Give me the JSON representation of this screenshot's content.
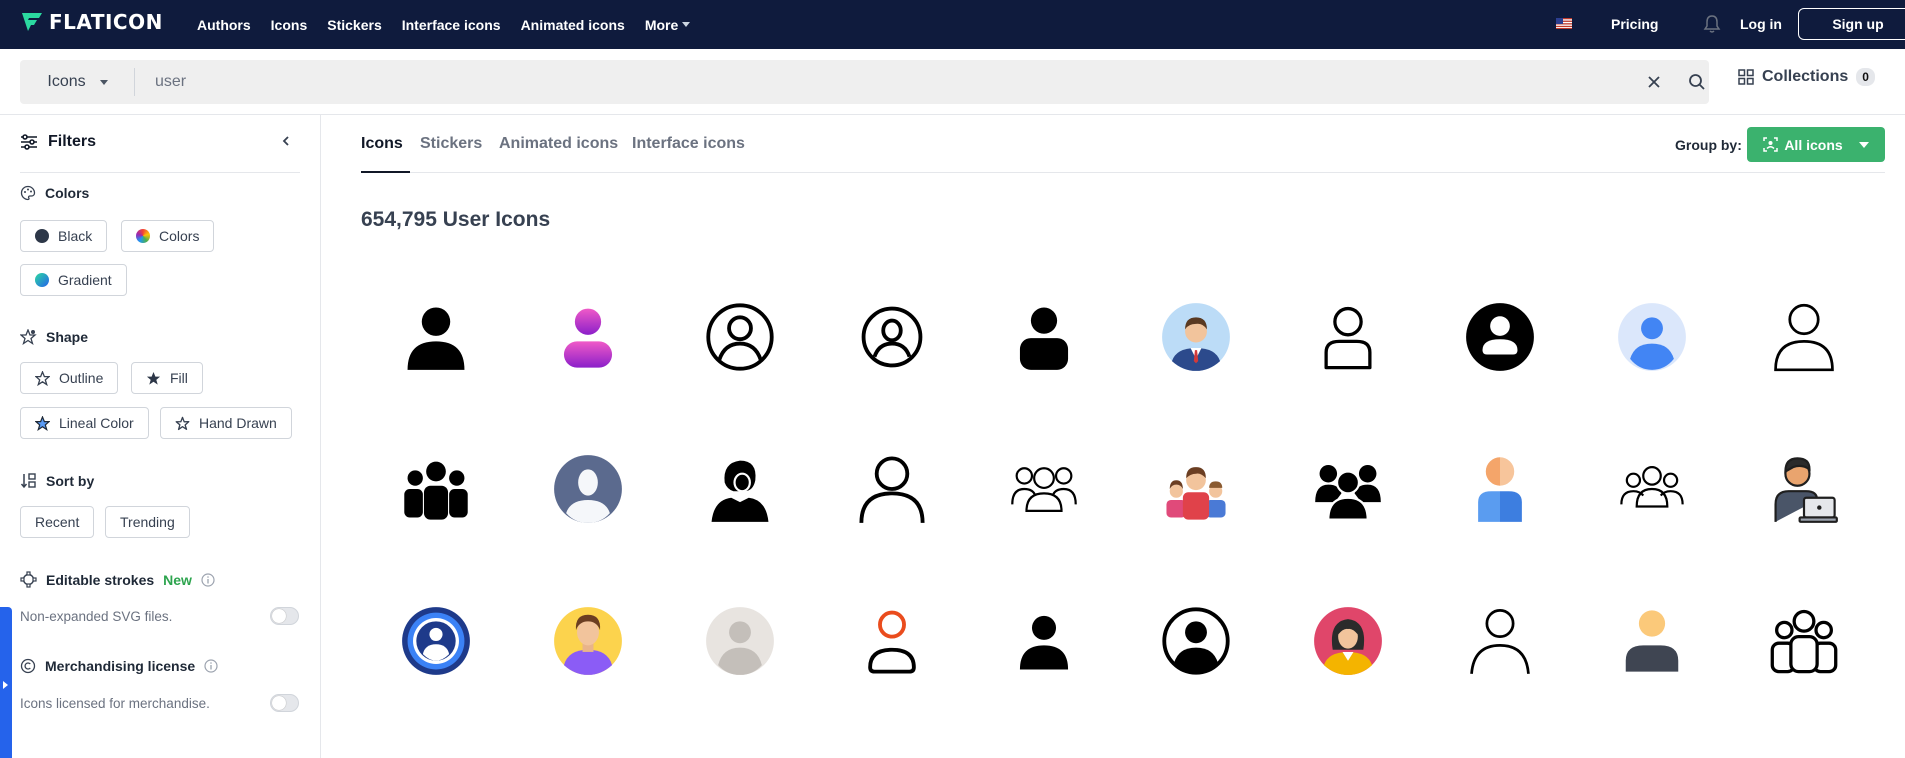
{
  "app": {
    "logo_text": "FLATICON",
    "brand_color": "#2bd9a0"
  },
  "nav": {
    "links": [
      "Authors",
      "Icons",
      "Stickers",
      "Interface icons",
      "Animated icons"
    ],
    "more_label": "More",
    "pricing_label": "Pricing",
    "login_label": "Log in",
    "signup_label": "Sign up"
  },
  "search": {
    "type_label": "Icons",
    "value": "user",
    "collections_label": "Collections",
    "collections_count": "0"
  },
  "filters": {
    "title": "Filters",
    "colors": {
      "title": "Colors",
      "options": [
        "Black",
        "Colors",
        "Gradient"
      ]
    },
    "shape": {
      "title": "Shape",
      "options": [
        "Outline",
        "Fill",
        "Lineal Color",
        "Hand Drawn"
      ]
    },
    "sort": {
      "title": "Sort by",
      "options": [
        "Recent",
        "Trending"
      ]
    },
    "editable_strokes": {
      "title": "Editable strokes",
      "badge": "New",
      "description": "Non-expanded SVG files.",
      "enabled": false
    },
    "merch_license": {
      "title": "Merchandising license",
      "description": "Icons licensed for merchandise.",
      "enabled": false
    }
  },
  "content_tabs": {
    "items": [
      "Icons",
      "Stickers",
      "Animated icons",
      "Interface icons"
    ],
    "active": "Icons"
  },
  "group_by": {
    "label": "Group by:",
    "value": "All icons",
    "button_color": "#3bb26e"
  },
  "results": {
    "title": "654,795 User Icons",
    "icons": [
      "user-black-fill-icon",
      "user-magenta-gradient-icon",
      "user-circle-outline-icon",
      "user-circle-outline-icon-2",
      "user-black-rounded-icon",
      "businessman-avatar-icon",
      "user-outline-icon",
      "user-circle-filled-icon",
      "user-blue-circle-icon",
      "user-thin-outline-icon",
      "group-black-fill-icon",
      "avatar-placeholder-icon",
      "woman-black-silhouette-icon",
      "user-large-outline-icon",
      "group-outline-icon",
      "team-color-icon",
      "group-black-rounded-icon",
      "user-orange-blue-icon",
      "group-thin-outline-icon",
      "user-laptop-icon",
      "user-blue-target-icon",
      "man-yellow-avatar-icon",
      "user-gray-circle-icon",
      "user-red-outline-icon",
      "user-small-black-icon",
      "user-circle-black-icon",
      "woman-red-avatar-icon",
      "user-thin-line-icon",
      "user-yellow-dark-icon",
      "group-three-outline-icon"
    ]
  }
}
